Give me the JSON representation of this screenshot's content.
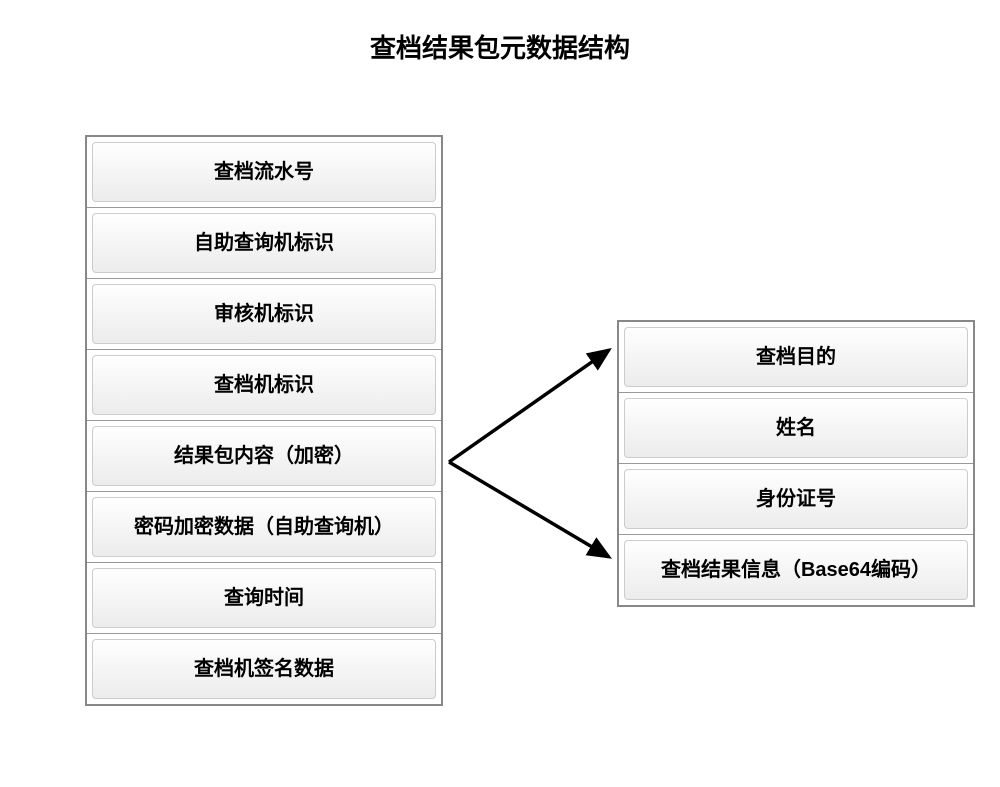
{
  "title": "查档结果包元数据结构",
  "leftBox": {
    "rows": [
      "查档流水号",
      "自助查询机标识",
      "审核机标识",
      "查档机标识",
      "结果包内容（加密）",
      "密码加密数据（自助查询机）",
      "查询时间",
      "查档机签名数据"
    ]
  },
  "rightBox": {
    "rows": [
      "查档目的",
      "姓名",
      "身份证号",
      "查档结果信息（Base64编码）"
    ]
  }
}
